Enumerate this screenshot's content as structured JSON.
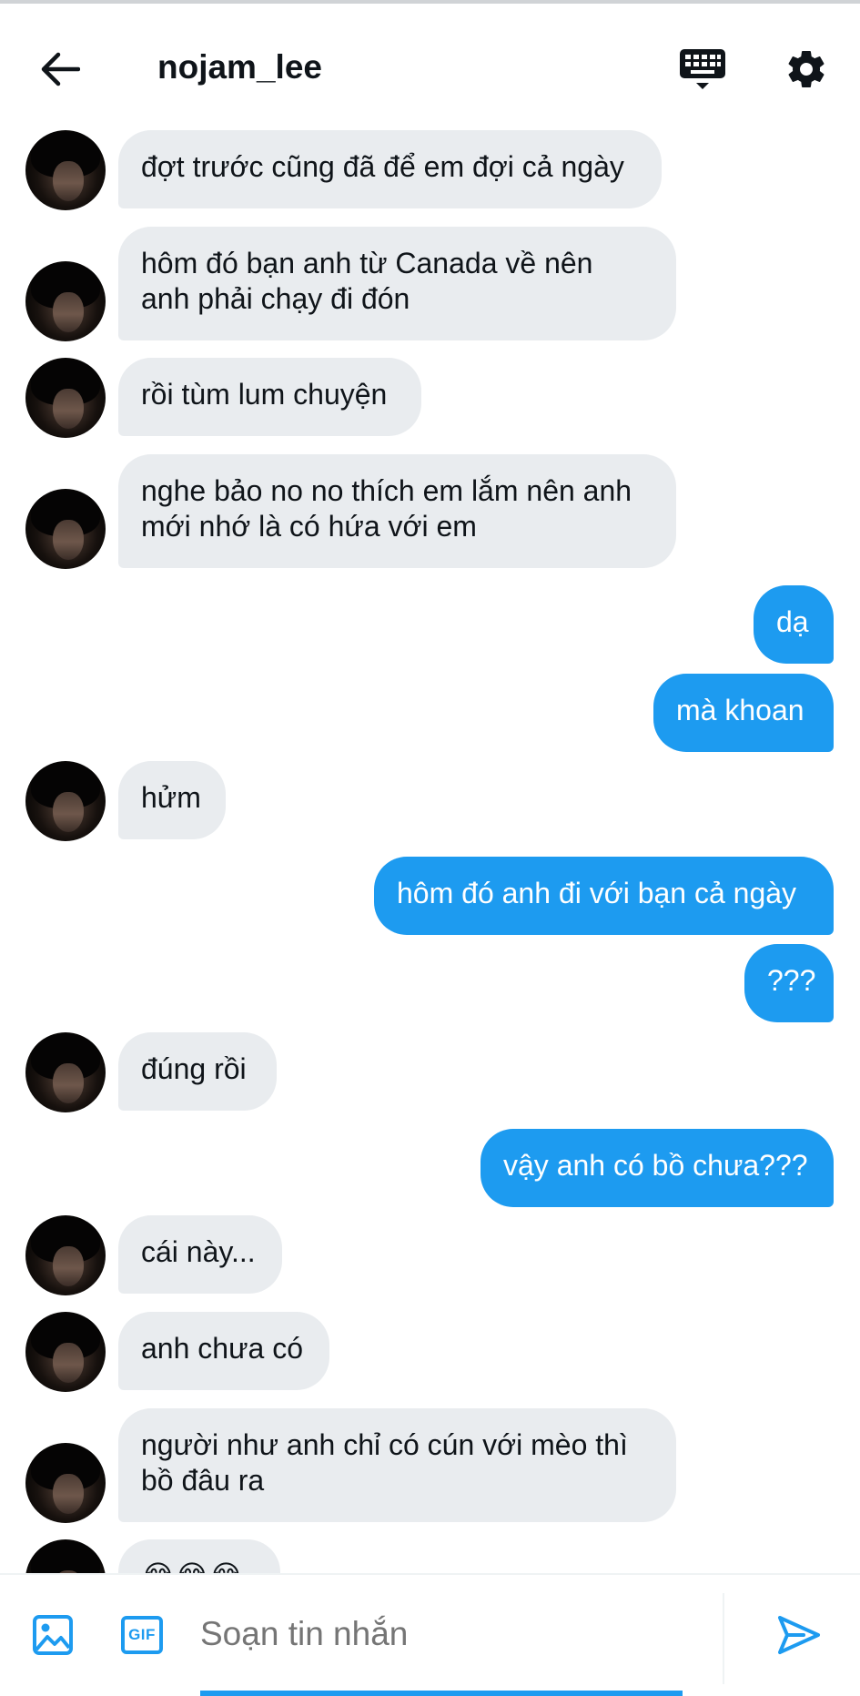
{
  "header": {
    "title": "nojam_lee"
  },
  "messages": [
    {
      "side": "in",
      "text": "đợt trước cũng đã để em đợi cả ngày"
    },
    {
      "side": "in",
      "text": "hôm đó bạn anh từ Canada về nên\nanh phải chạy đi đón"
    },
    {
      "side": "in",
      "text": "rồi tùm lum chuyện"
    },
    {
      "side": "in",
      "text": "nghe bảo no no thích em lắm nên anh\nmới nhớ là có hứa với em"
    },
    {
      "side": "out",
      "text": "dạ"
    },
    {
      "side": "out",
      "text": "mà khoan"
    },
    {
      "side": "in",
      "text": "hửm"
    },
    {
      "side": "out",
      "text": "hôm đó anh đi với bạn cả ngày"
    },
    {
      "side": "out",
      "text": "???"
    },
    {
      "side": "in",
      "text": "đúng rồi"
    },
    {
      "side": "out",
      "text": "vậy anh có bồ chưa???"
    },
    {
      "side": "in",
      "text": "cái này..."
    },
    {
      "side": "in",
      "text": "anh chưa có"
    },
    {
      "side": "in",
      "text": "người như anh chỉ có cún với mèo thì\nbồ đâu ra"
    },
    {
      "side": "in",
      "text": "😂😂😂"
    }
  ],
  "composer": {
    "gif_label": "GIF",
    "placeholder": "Soạn tin nhắn"
  },
  "icons": {
    "back": "arrow-left-icon",
    "keyboard": "keyboard-icon",
    "settings": "gear-icon",
    "image": "image-icon",
    "gif": "gif-icon",
    "send": "send-icon"
  },
  "colors": {
    "accent": "#1d9bf0",
    "incoming_bubble": "#e9ecef",
    "text": "#0f1419",
    "placeholder": "#536471"
  }
}
